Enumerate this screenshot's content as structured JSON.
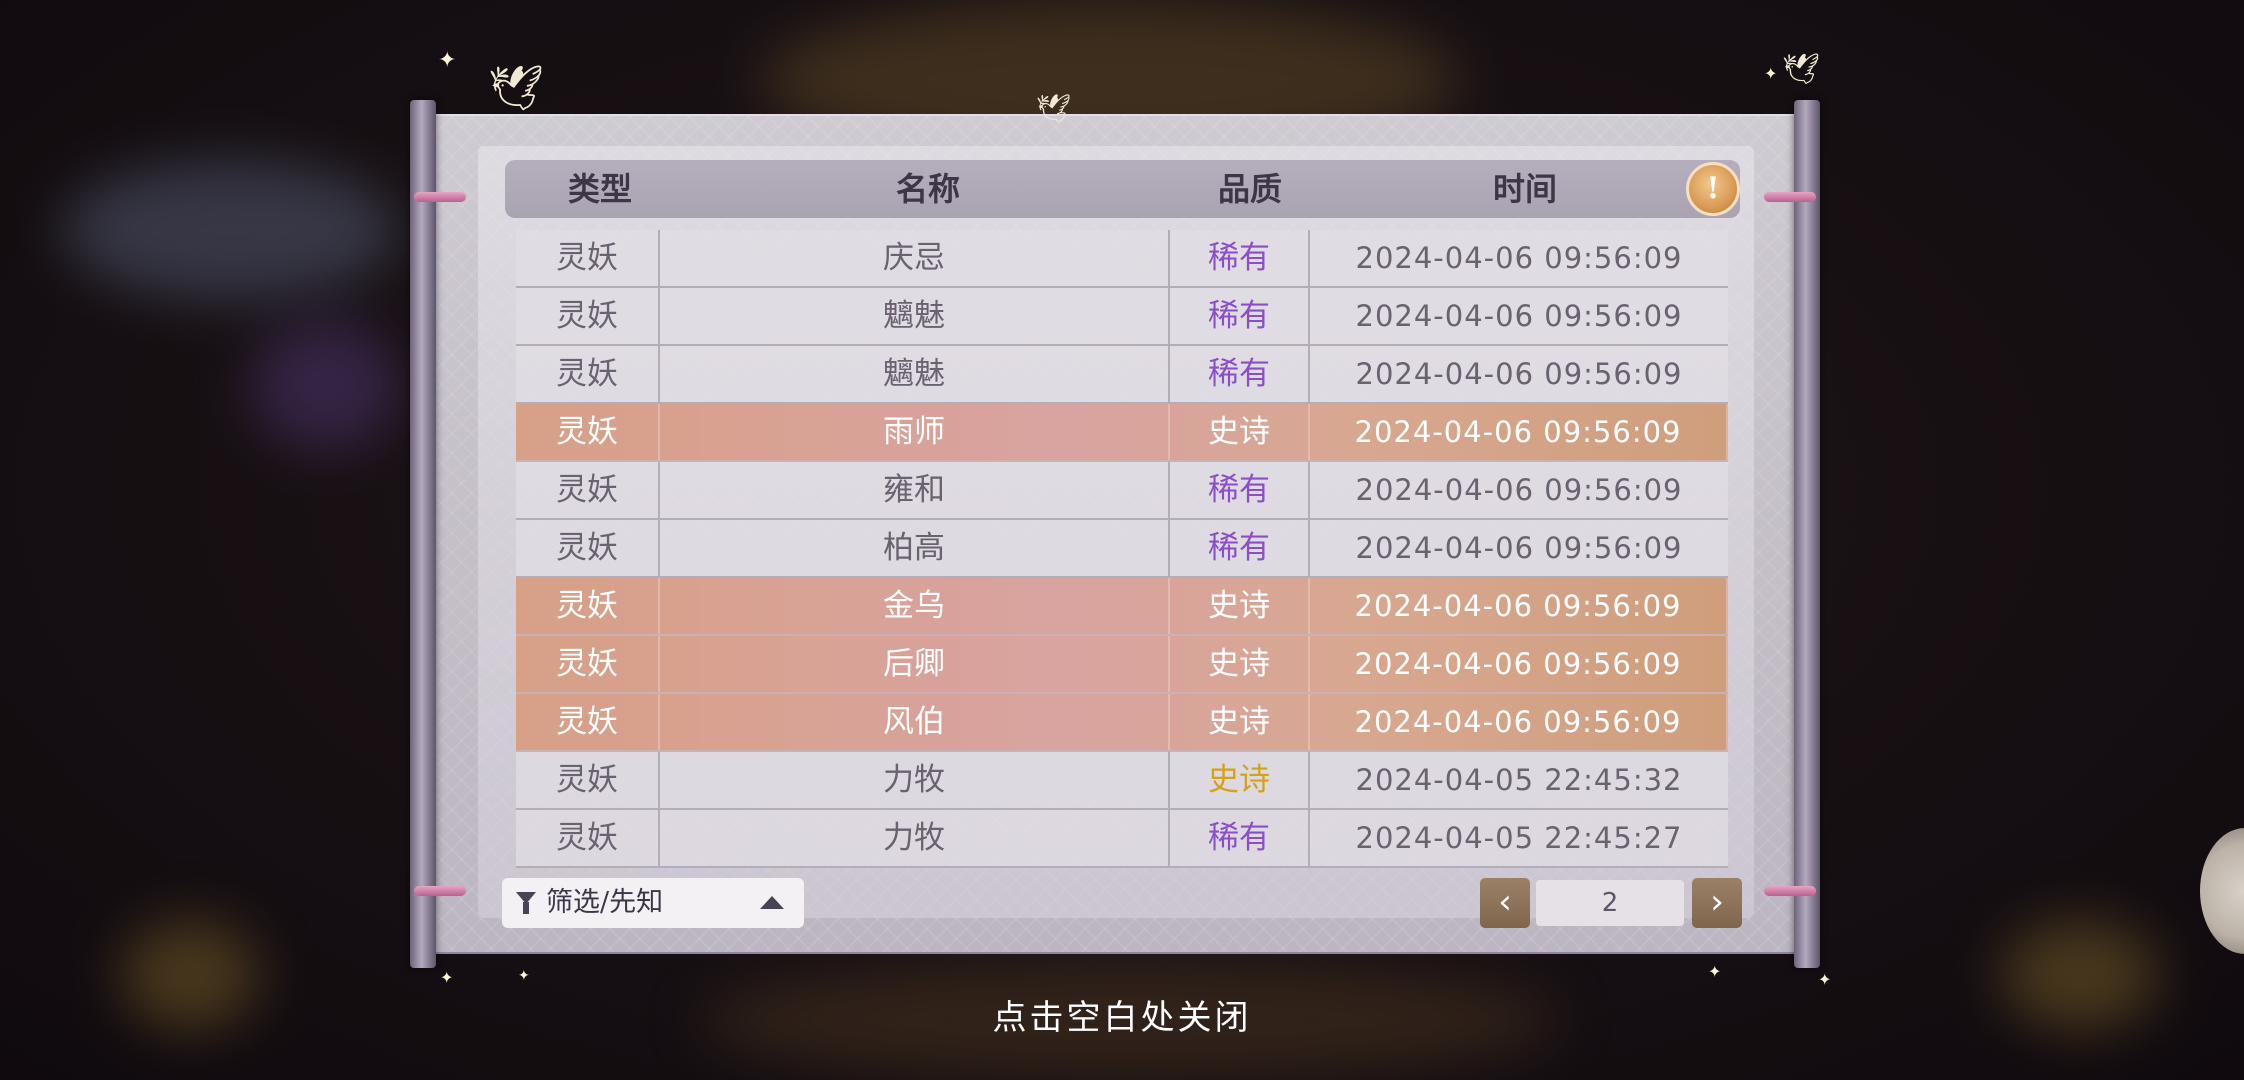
{
  "table": {
    "headers": [
      "类型",
      "名称",
      "品质",
      "时间"
    ],
    "rows": [
      {
        "type": "灵妖",
        "name": "庆忌",
        "quality": "稀有",
        "time": "2024-04-06  09:56:09",
        "epic": false,
        "quality_color": "#8a4fc7"
      },
      {
        "type": "灵妖",
        "name": "魑魅",
        "quality": "稀有",
        "time": "2024-04-06  09:56:09",
        "epic": false,
        "quality_color": "#8a4fc7"
      },
      {
        "type": "灵妖",
        "name": "魑魅",
        "quality": "稀有",
        "time": "2024-04-06  09:56:09",
        "epic": false,
        "quality_color": "#8a4fc7"
      },
      {
        "type": "灵妖",
        "name": "雨师",
        "quality": "史诗",
        "time": "2024-04-06  09:56:09",
        "epic": true,
        "quality_color": "#ffffff"
      },
      {
        "type": "灵妖",
        "name": "雍和",
        "quality": "稀有",
        "time": "2024-04-06  09:56:09",
        "epic": false,
        "quality_color": "#8a4fc7"
      },
      {
        "type": "灵妖",
        "name": "柏高",
        "quality": "稀有",
        "time": "2024-04-06  09:56:09",
        "epic": false,
        "quality_color": "#8a4fc7"
      },
      {
        "type": "灵妖",
        "name": "金乌",
        "quality": "史诗",
        "time": "2024-04-06  09:56:09",
        "epic": true,
        "quality_color": "#ffffff"
      },
      {
        "type": "灵妖",
        "name": "后卿",
        "quality": "史诗",
        "time": "2024-04-06  09:56:09",
        "epic": true,
        "quality_color": "#ffffff"
      },
      {
        "type": "灵妖",
        "name": "风伯",
        "quality": "史诗",
        "time": "2024-04-06  09:56:09",
        "epic": true,
        "quality_color": "#ffffff"
      },
      {
        "type": "灵妖",
        "name": "力牧",
        "quality": "史诗",
        "time": "2024-04-05  22:45:32",
        "epic": false,
        "quality_color": "#d4a21a"
      },
      {
        "type": "灵妖",
        "name": "力牧",
        "quality": "稀有",
        "time": "2024-04-05  22:45:27",
        "epic": false,
        "quality_color": "#8a4fc7"
      }
    ]
  },
  "info_button_icon": "exclamation-icon",
  "filter": {
    "label": "筛选/先知",
    "icon": "funnel-icon"
  },
  "pager": {
    "prev": "‹",
    "next": "›",
    "page": "2"
  },
  "close_hint": "点击空白处关闭"
}
